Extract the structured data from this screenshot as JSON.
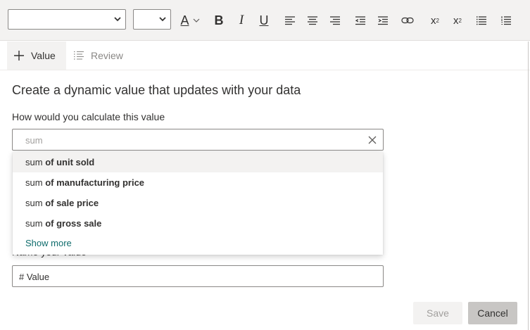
{
  "toolbar": {
    "font_select_value": "",
    "size_select_value": "",
    "buttons": {
      "font_color": "A",
      "bold": "B",
      "italic": "I",
      "underline": "U",
      "superscript": "x",
      "superscript_mark": "2",
      "subscript": "x",
      "subscript_mark": "2"
    },
    "icons": [
      "chevron-down-icon",
      "font-color-icon",
      "bold-icon",
      "italic-icon",
      "underline-icon",
      "align-left-icon",
      "align-center-icon",
      "align-right-icon",
      "outdent-icon",
      "indent-icon",
      "link-icon",
      "superscript-icon",
      "subscript-icon",
      "bullet-list-icon",
      "numbered-list-icon"
    ]
  },
  "tabs": [
    {
      "label": "Value",
      "icon": "plus-icon",
      "active": true
    },
    {
      "label": "Review",
      "icon": "list-icon",
      "active": false
    }
  ],
  "form": {
    "heading": "Create a dynamic value that updates with your data",
    "calc_label": "How would you calculate this value",
    "calc_value": "sum",
    "suggestions": [
      {
        "prefix": "sum",
        "rest": "of unit sold"
      },
      {
        "prefix": "sum",
        "rest": "of manufacturing price"
      },
      {
        "prefix": "sum",
        "rest": "of sale price"
      },
      {
        "prefix": "sum",
        "rest": "of gross sale"
      }
    ],
    "show_more": "Show more",
    "name_label": "Name your value",
    "name_value": "# Value"
  },
  "actions": {
    "save": "Save",
    "cancel": "Cancel"
  },
  "colors": {
    "toolbar_bg": "#f3f2f1",
    "accent": "#0f6c6c",
    "border": "#8a8886"
  }
}
